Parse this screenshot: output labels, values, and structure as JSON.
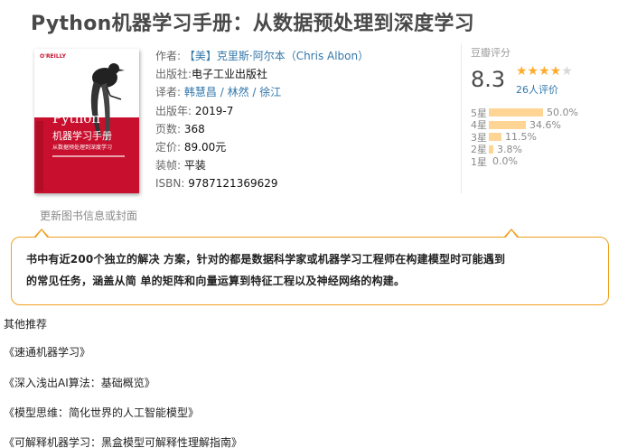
{
  "title": "Python机器学习手册：从数据预处理到深度学习",
  "cover": {
    "publisher_logo": "O'REILLY",
    "title_en": "Python",
    "title_cn": "机器学习手册",
    "subtitle_cn": "从数据预处理到深度学习",
    "update_link": "更新图书信息或封面"
  },
  "info": {
    "author_label": "作者:",
    "author": "【美】克里斯·阿尔本（Chris Albon）",
    "publisher_label": "出版社:",
    "publisher": "电子工业出版社",
    "translator_label": "译者:",
    "translators": [
      "韩慧昌",
      "林然",
      "徐江"
    ],
    "translator_sep": " / ",
    "date_label": "出版年:",
    "date": "2019-7",
    "pages_label": "页数:",
    "pages": "368",
    "price_label": "定价:",
    "price": "89.00元",
    "binding_label": "装帧:",
    "binding": "平装",
    "isbn_label": "ISBN:",
    "isbn": "9787121369629"
  },
  "rating": {
    "title": "豆瓣评分",
    "score": "8.3",
    "stars_on": "★★★★",
    "stars_off": "★",
    "count": "26人评价",
    "distribution": [
      {
        "label": "5星",
        "percent": "50.0%",
        "fraction": 0.5
      },
      {
        "label": "4星",
        "percent": "34.6%",
        "fraction": 0.346
      },
      {
        "label": "3星",
        "percent": "11.5%",
        "fraction": 0.115
      },
      {
        "label": "2星",
        "percent": "3.8%",
        "fraction": 0.038
      },
      {
        "label": "1星",
        "percent": "0.0%",
        "fraction": 0.0
      }
    ],
    "colors": {
      "stars": "#ffac2d",
      "bar": "#ffd596"
    }
  },
  "description": {
    "line1": "书中有近200个独立的解决 方案，针对的都是数据科学家或机器学习工程师在构建模型时可能遇到",
    "line2": "的常见任务，涵盖从简 单的矩阵和向量运算到特征工程以及神经网络的构建。",
    "border_color": "#f0a020"
  },
  "recommendations": {
    "heading": "其他推荐",
    "items": [
      "《速通机器学习》",
      "《深入浅出AI算法：基础概览》",
      "《模型思维：简化世界的人工智能模型》",
      "《可解释机器学习：黑盒模型可解释性理解指南》"
    ]
  }
}
